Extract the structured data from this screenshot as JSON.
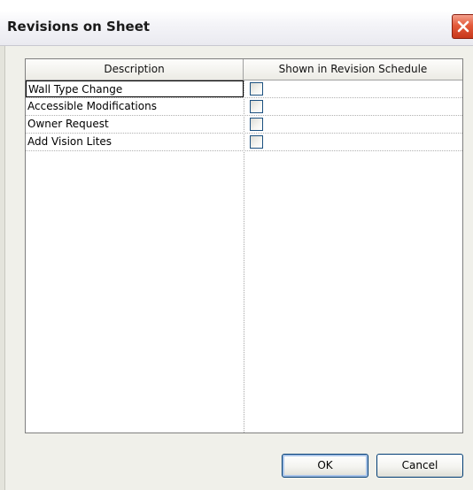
{
  "window": {
    "title": "Revisions on Sheet",
    "close_icon": "close-icon"
  },
  "grid": {
    "columns": [
      "Description",
      "Shown in Revision Schedule"
    ],
    "rows": [
      {
        "description": "Wall Type Change",
        "shown": false,
        "selected": true
      },
      {
        "description": "Accessible Modifications",
        "shown": false,
        "selected": false
      },
      {
        "description": "Owner Request",
        "shown": false,
        "selected": false
      },
      {
        "description": "Add Vision Lites",
        "shown": false,
        "selected": false
      }
    ]
  },
  "buttons": {
    "ok_label": "OK",
    "cancel_label": "Cancel"
  },
  "colors": {
    "close_button": "#e35a3a",
    "checkbox_border": "#1c5180",
    "ok_focus": "#a9c4e8"
  }
}
